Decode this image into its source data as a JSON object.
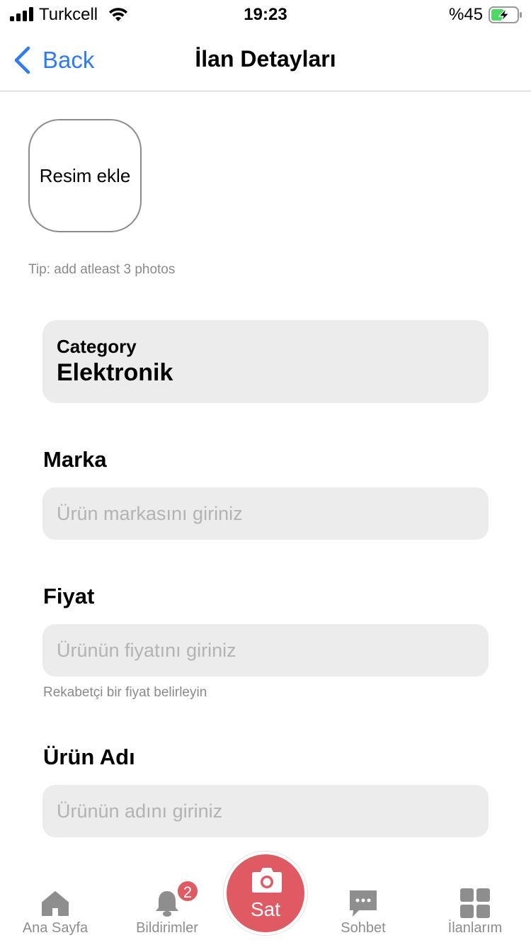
{
  "status_bar": {
    "carrier": "Turkcell",
    "time": "19:23",
    "battery_percent": "%45"
  },
  "nav": {
    "back_label": "Back",
    "title": "İlan Detayları"
  },
  "photo": {
    "add_label": "Resim ekle",
    "tip": "Tip: add atleast 3 photos"
  },
  "category": {
    "label": "Category",
    "value": "Elektronik"
  },
  "fields": {
    "brand": {
      "label": "Marka",
      "placeholder": "Ürün markasını giriniz"
    },
    "price": {
      "label": "Fiyat",
      "placeholder": "Ürünün fiyatını giriniz",
      "hint": "Rekabetçi bir fiyat belirleyin"
    },
    "name": {
      "label": "Ürün Adı",
      "placeholder": "Ürünün adını giriniz"
    }
  },
  "tab_bar": {
    "home": {
      "label": "Ana Sayfa",
      "icon": "home-icon"
    },
    "notifications": {
      "label": "Bildirimler",
      "icon": "bell-icon",
      "badge": "2"
    },
    "sell": {
      "label": "Sat",
      "icon": "camera-icon"
    },
    "chat": {
      "label": "Sohbet",
      "icon": "chat-icon"
    },
    "listings": {
      "label": "İlanlarım",
      "icon": "grid-icon"
    }
  },
  "colors": {
    "accent_blue": "#2f7bf6",
    "sell_red": "#e05a63",
    "input_bg": "#ececec",
    "tab_gray": "#8e8e8e"
  }
}
